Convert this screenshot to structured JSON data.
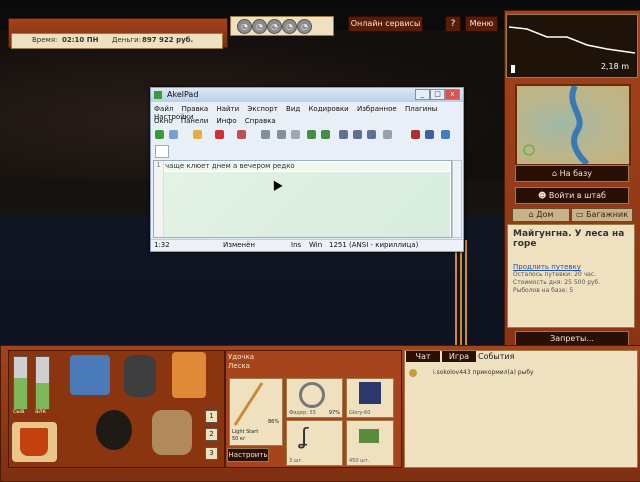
{
  "top_info": {
    "time_label": "Время:",
    "time_value": "02:10 ПН",
    "money_label": "Деньги:",
    "money_value": "897 922 руб."
  },
  "header_buttons": {
    "online": "Онлайн сервисы",
    "help": "?",
    "menu": "Меню"
  },
  "right_panel": {
    "depth_value": "2,18 m",
    "to_base": "На базу",
    "to_hq": "Войти в штаб",
    "tab_home": "Дом",
    "tab_luggage": "Багажник",
    "location_title": "Майгунгна. У леса на горе",
    "extend_link": "Продлить путевку",
    "trip_left": "Осталось путевки: 20 час.",
    "day_cost": "Стоимость дня: 25 500 руб.",
    "anglers": "Рыболов на базе: 5",
    "bans": "Запреты..."
  },
  "inventory": {
    "gauge1_label": "сыв",
    "gauge2_label": "алк",
    "gauge1_level": 0.6,
    "gauge2_level": 0.5,
    "slots": [
      "1",
      "2",
      "3"
    ]
  },
  "rod_panel": {
    "title_rod": "Удочка",
    "title_line": "Леска",
    "rod_name": "Light Start",
    "rod_weight": "50 кг",
    "rod_pct": "86%",
    "reel_label": "Фидер: 55",
    "reel_pct": "97%",
    "cell3_label": "Glory-60",
    "hook_label": "3 шт.",
    "bait_label": "450 шт.",
    "setup": "Настроить"
  },
  "chat": {
    "tabs": [
      "Чат",
      "Игра",
      "События"
    ],
    "message": "i.sokolov443 прикормил(а) рыбу"
  },
  "akelpad": {
    "title": "AkelPad",
    "menu1": [
      "Файл",
      "Правка",
      "Найти",
      "Экспорт",
      "Вид",
      "Кодировки",
      "Избранное",
      "Плагины",
      "Настройки"
    ],
    "menu2": [
      "Окно",
      "Панели",
      "Инфо",
      "Справка"
    ],
    "line_number": "1",
    "text": "чаще клюет днем а вечером редко",
    "status": {
      "pos": "1:32",
      "modified": "Изменён",
      "ins": "Ins",
      "eol": "Win",
      "encoding": "1251 (ANSI - кириллица)"
    }
  },
  "colors": {
    "wood": "#a4421d",
    "parchment": "#efe1bf",
    "button_dark": "#2a0f04"
  }
}
